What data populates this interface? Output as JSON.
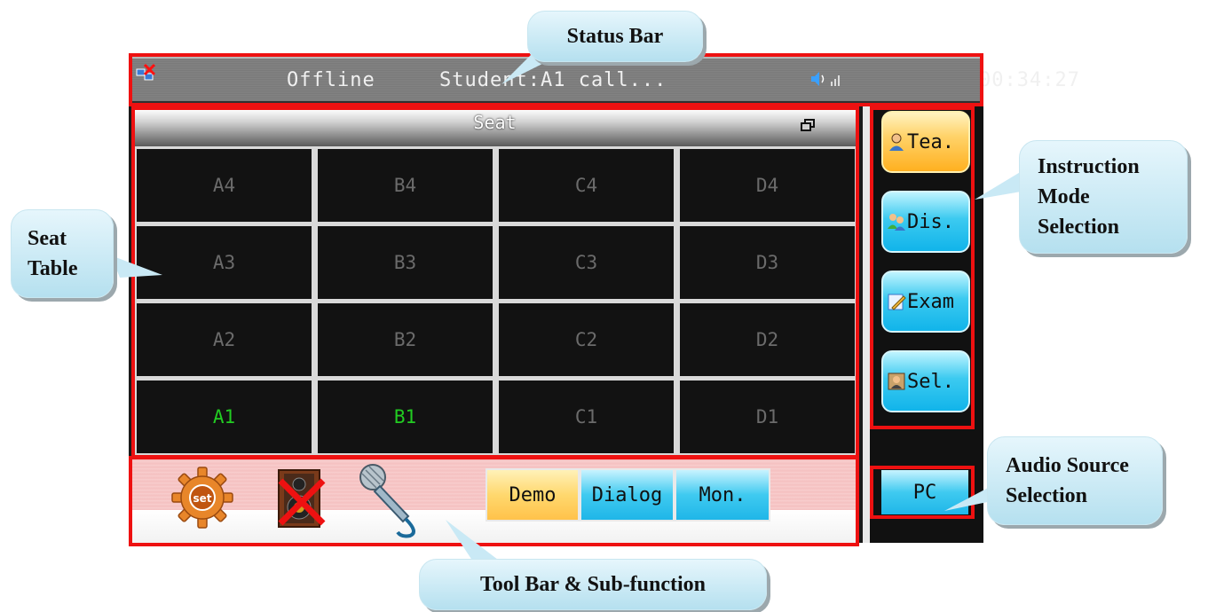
{
  "status_bar": {
    "connection": "Offline",
    "message": "Student:A1 call...",
    "time": "00:34:27",
    "icons": [
      "network-offline-icon",
      "speaker-signal-icon"
    ]
  },
  "seat_panel": {
    "title": "Seat",
    "seats": [
      {
        "label": "A4",
        "active": false
      },
      {
        "label": "B4",
        "active": false
      },
      {
        "label": "C4",
        "active": false
      },
      {
        "label": "D4",
        "active": false
      },
      {
        "label": "A3",
        "active": false
      },
      {
        "label": "B3",
        "active": false
      },
      {
        "label": "C3",
        "active": false
      },
      {
        "label": "D3",
        "active": false
      },
      {
        "label": "A2",
        "active": false
      },
      {
        "label": "B2",
        "active": false
      },
      {
        "label": "C2",
        "active": false
      },
      {
        "label": "D2",
        "active": false
      },
      {
        "label": "A1",
        "active": true
      },
      {
        "label": "B1",
        "active": true
      },
      {
        "label": "C1",
        "active": false
      },
      {
        "label": "D1",
        "active": false
      }
    ],
    "colors": {
      "active": "#22cc22",
      "inactive": "#6b6b6b"
    }
  },
  "mode_buttons": [
    {
      "label": "Tea.",
      "icon": "teacher-icon",
      "selected": true
    },
    {
      "label": "Dis.",
      "icon": "discussion-icon",
      "selected": false
    },
    {
      "label": "Exam",
      "icon": "exam-icon",
      "selected": false
    },
    {
      "label": "Sel.",
      "icon": "select-icon",
      "selected": false
    }
  ],
  "audio_source": {
    "label": "PC"
  },
  "toolbar": {
    "icons": [
      "settings-gear-icon",
      "speaker-muted-icon",
      "microphone-icon"
    ],
    "gear_text": "set",
    "sub_functions": [
      {
        "label": "Demo",
        "selected": true
      },
      {
        "label": "Dialog",
        "selected": false
      },
      {
        "label": "Mon.",
        "selected": false
      }
    ]
  },
  "callouts": {
    "status_bar": "Status Bar",
    "seat_table": "Seat\nTable",
    "instruction_mode": "Instruction\nMode\nSelection",
    "audio_source": "Audio Source\nSelection",
    "toolbar": "Tool Bar & Sub-function"
  },
  "colors": {
    "frame": "#ee1111",
    "callout": "#c2e6f3",
    "button_blue": "#1fb6e8",
    "button_orange": "#ffb020"
  }
}
